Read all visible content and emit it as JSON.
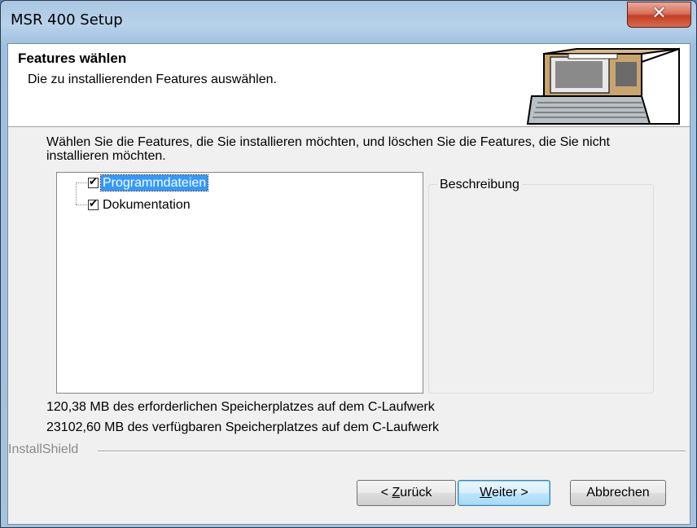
{
  "window": {
    "title": "MSR 400 Setup",
    "close_glyph": "✕"
  },
  "header": {
    "title": "Features wählen",
    "subtitle": "Die zu installierenden Features auswählen.",
    "icon": "typewriter-computer-illustration"
  },
  "description": "Wählen Sie die Features, die Sie installieren möchten, und löschen Sie die Features, die Sie nicht installieren möchten.",
  "features": [
    {
      "label": "Programmdateien",
      "checked": true,
      "selected": true
    },
    {
      "label": "Dokumentation",
      "checked": true,
      "selected": false
    }
  ],
  "checkmark": "✔",
  "description_group": {
    "label": "Beschreibung",
    "text": ""
  },
  "space": {
    "required": "120,38 MB des erforderlichen Speicherplatzes auf dem C-Laufwerk",
    "available": "23102,60 MB des verfügbaren Speicherplatzes auf dem C-Laufwerk"
  },
  "brand": "InstallShield",
  "buttons": {
    "back": {
      "prefix": "< ",
      "accel": "Z",
      "rest": "urück"
    },
    "next": {
      "accel": "W",
      "rest": "eiter >"
    },
    "cancel": "Abbrechen"
  }
}
